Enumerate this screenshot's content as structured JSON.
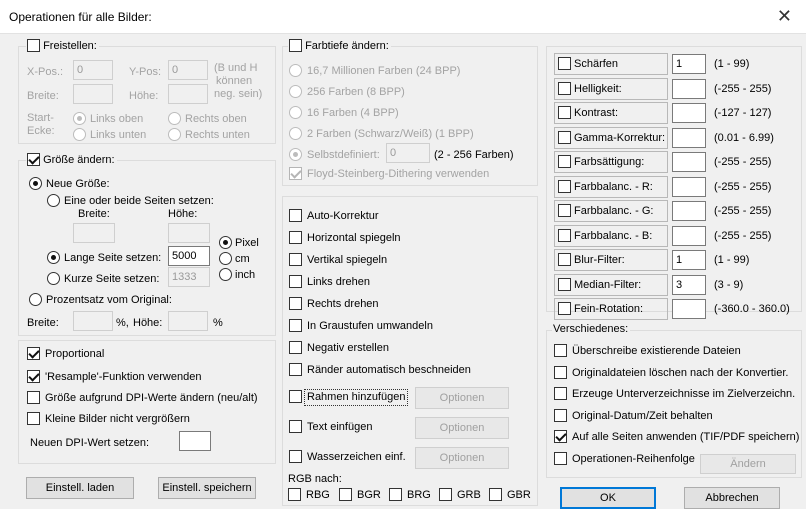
{
  "window": {
    "title": "Operationen für alle Bilder:",
    "close_glyph": "✕"
  },
  "crop": {
    "label": "Freistellen:",
    "checked": false,
    "xpos_label": "X-Pos.:",
    "xpos_value": "0",
    "ypos_label": "Y-Pos:",
    "ypos_value": "0",
    "note": [
      "(B und H",
      "können",
      "neg. sein)"
    ],
    "width_label": "Breite:",
    "height_label": "Höhe:",
    "corner_label": [
      "Start-",
      "Ecke:"
    ],
    "corners": [
      "Links oben",
      "Rechts oben",
      "Links unten",
      "Rechts unten"
    ]
  },
  "resize": {
    "label": "Größe ändern:",
    "checked": true,
    "new_size": "Neue Größe:",
    "one_or_both": "Eine oder beide Seiten setzen:",
    "width_label": "Breite:",
    "height_label": "Höhe:",
    "long_side": "Lange Seite setzen:",
    "long_value": "5000",
    "short_side": "Kurze Seite setzen:",
    "short_value": "1333",
    "units": [
      "Pixel",
      "cm",
      "inch"
    ],
    "percent": "Prozentsatz vom Original:",
    "pct_width_label": "Breite:",
    "pct_sign": "%,",
    "pct_height_label": "Höhe:",
    "pct_sign2": "%"
  },
  "options": {
    "proportional": "Proportional",
    "resample": "'Resample'-Funktion verwenden",
    "dpi_size": "Größe aufgrund DPI-Werte ändern (neu/alt)",
    "no_enlarge": "Kleine Bilder nicht vergrößern",
    "dpi_label": "Neuen DPI-Wert setzen:",
    "dpi_value": ""
  },
  "buttons": {
    "load": "Einstell. laden",
    "save": "Einstell. speichern",
    "ok": "OK",
    "cancel": "Abbrechen",
    "options": "Optionen",
    "change": "Ändern"
  },
  "color_depth": {
    "label": "Farbtiefe ändern:",
    "items": [
      "16,7 Millionen Farben (24 BPP)",
      "256 Farben (8 BPP)",
      "16 Farben (4 BPP)",
      "2 Farben (Schwarz/Weiß) (1 BPP)"
    ],
    "custom": "Selbstdefiniert:",
    "custom_value": "0",
    "custom_range": "(2 - 256 Farben)",
    "dither": "Floyd-Steinberg-Dithering verwenden"
  },
  "transforms": {
    "items": [
      "Auto-Korrektur",
      "Horizontal spiegeln",
      "Vertikal spiegeln",
      "Links drehen",
      "Rechts drehen",
      "In Graustufen umwandeln",
      "Negativ erstellen",
      "Ränder automatisch beschneiden"
    ],
    "frame": "Rahmen hinzufügen",
    "text": "Text einfügen",
    "watermark": "Wasserzeichen einf.",
    "rgb_label": "RGB nach:",
    "rgb": [
      "RBG",
      "BGR",
      "BRG",
      "GRB",
      "GBR"
    ]
  },
  "adjust": [
    {
      "label": "Schärfen",
      "value": "1",
      "range": "(1 - 99)"
    },
    {
      "label": "Helligkeit:",
      "value": "",
      "range": "(-255 - 255)"
    },
    {
      "label": "Kontrast:",
      "value": "",
      "range": "(-127 - 127)"
    },
    {
      "label": "Gamma-Korrektur:",
      "value": "",
      "range": "(0.01 - 6.99)"
    },
    {
      "label": "Farbsättigung:",
      "value": "",
      "range": "(-255 - 255)"
    },
    {
      "label": "Farbbalanc. - R:",
      "value": "",
      "range": "(-255 - 255)"
    },
    {
      "label": "Farbbalanc. - G:",
      "value": "",
      "range": "(-255 - 255)"
    },
    {
      "label": "Farbbalanc. - B:",
      "value": "",
      "range": "(-255 - 255)"
    },
    {
      "label": "Blur-Filter:",
      "value": "1",
      "range": "(1 - 99)"
    },
    {
      "label": "Median-Filter:",
      "value": "3",
      "range": "(3 - 9)"
    },
    {
      "label": "Fein-Rotation:",
      "value": "",
      "range": "(-360.0 - 360.0)"
    }
  ],
  "misc": {
    "label": "Verschiedenes:",
    "items": [
      "Überschreibe existierende Dateien",
      "Originaldateien löschen nach der Konvertier.",
      "Erzeuge Unterverzeichnisse im Zielverzeichn.",
      "Original-Datum/Zeit behalten",
      "Auf alle Seiten anwenden (TIF/PDF speichern)",
      "Operationen-Reihenfolge"
    ]
  }
}
